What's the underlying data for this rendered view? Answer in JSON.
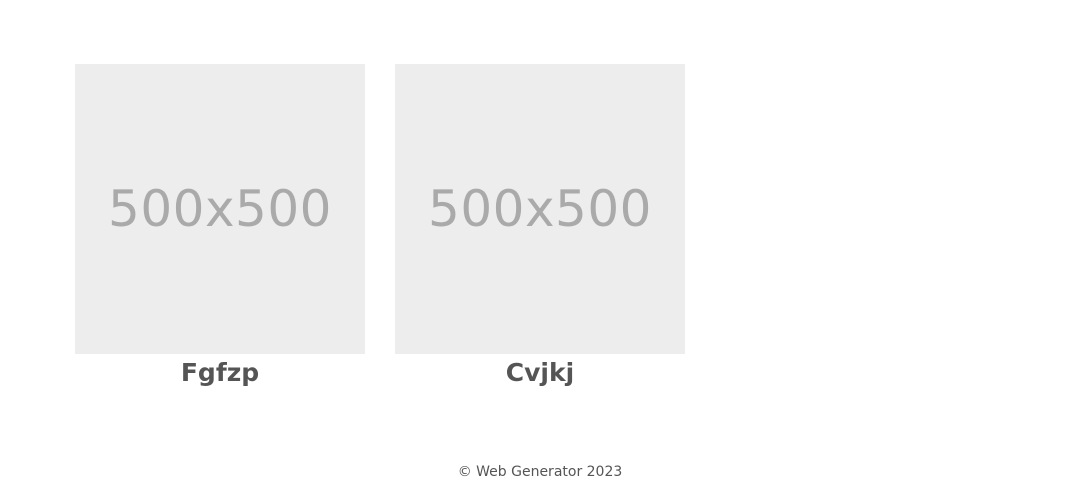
{
  "gallery": {
    "items": [
      {
        "placeholder": "500x500",
        "title": "Fgfzp"
      },
      {
        "placeholder": "500x500",
        "title": "Cvjkj"
      }
    ]
  },
  "footer": {
    "text": "© Web Generator 2023"
  },
  "colors": {
    "placeholder_bg": "#ededed",
    "placeholder_text": "#aaaaaa",
    "title_text": "#555555",
    "footer_text": "#555555"
  }
}
